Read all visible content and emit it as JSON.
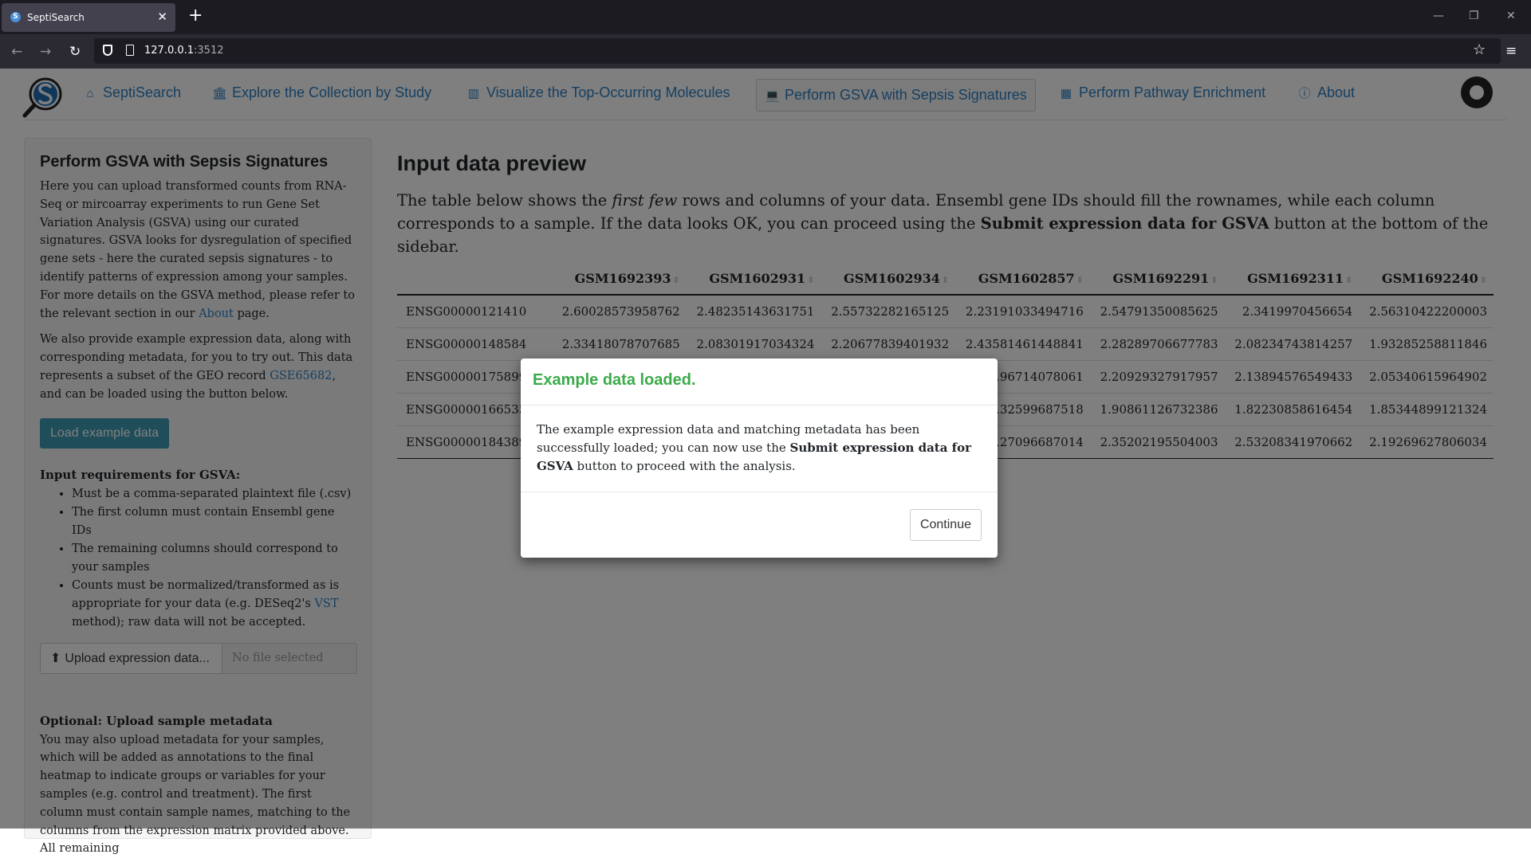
{
  "browser": {
    "tab_title": "SeptiSearch",
    "url_host": "127.0.0.1",
    "url_port": ":3512"
  },
  "nav": {
    "items": [
      {
        "label": "SeptiSearch",
        "icon": "home-icon"
      },
      {
        "label": "Explore the Collection by Study",
        "icon": "institution-icon"
      },
      {
        "label": "Visualize the Top-Occurring Molecules",
        "icon": "bar-chart-icon"
      },
      {
        "label": "Perform GSVA with Sepsis Signatures",
        "icon": "laptop-icon"
      },
      {
        "label": "Perform Pathway Enrichment",
        "icon": "calculator-icon"
      },
      {
        "label": "About",
        "icon": "info-circle-icon"
      }
    ],
    "active_index": 3
  },
  "sidebar": {
    "title": "Perform GSVA with Sepsis Signatures",
    "intro_text": "Here you can upload transformed counts from RNA-Seq or mircoarray experiments to run Gene Set Variation Analysis (GSVA) using our curated signatures. GSVA looks for dysregulation of specified gene sets - here the curated sepsis signatures - to identify patterns of expression among your samples. For more details on the GSVA method, please refer to the relevant section in our ",
    "intro_link": "About",
    "intro_end": " page.",
    "example_text": "We also provide example expression data, along with corresponding metadata, for you to try out. This data represents a subset of the GEO record ",
    "example_link": "GSE65682",
    "example_end": ", and can be loaded using the button below.",
    "load_button": "Load example data",
    "req_heading": "Input requirements for GSVA:",
    "req_items": [
      "Must be a comma-separated plaintext file (.csv)",
      "The first column must contain Ensembl gene IDs",
      "The remaining columns should correspond to your samples"
    ],
    "req_last_start": "Counts must be normalized/transformed as is appropriate for your data (e.g. DESeq2's ",
    "req_last_link": "VST",
    "req_last_end": " method); raw data will not be accepted.",
    "upload_button": "Upload expression data...",
    "upload_placeholder": "No file selected",
    "opt_heading": "Optional: Upload sample metadata",
    "opt_text": "You may also upload metadata for your samples, which will be added as annotations to the final heatmap to indicate groups or variables for your samples (e.g. control and treatment). The first column must contain sample names, matching to the columns from the expression matrix provided above. All remaining"
  },
  "main": {
    "title": "Input data preview",
    "desc_start": "The table below shows the ",
    "desc_em": "first few",
    "desc_mid": " rows and columns of your data. Ensembl gene IDs should fill the rownames, while each column corresponds to a sample. If the data looks OK, you can proceed using the ",
    "desc_strong": "Submit expression data for GSVA",
    "desc_end": " button at the bottom of the sidebar.",
    "table": {
      "columns": [
        "GSM1692393",
        "GSM1602931",
        "GSM1602934",
        "GSM1602857",
        "GSM1692291",
        "GSM1692311",
        "GSM1692240"
      ],
      "rows": [
        {
          "id": "ENSG00000121410",
          "values": [
            "2.60028573958762",
            "2.48235143631751",
            "2.55732282165125",
            "2.23191033494716",
            "2.54791350085625",
            "2.3419970456654",
            "2.56310422200003"
          ]
        },
        {
          "id": "ENSG00000148584",
          "values": [
            "2.33418078707685",
            "2.08301917034324",
            "2.20677839401932",
            "2.43581461448841",
            "2.28289706677783",
            "2.08234743814257",
            "1.93285258811846"
          ]
        },
        {
          "id": "ENSG00000175899",
          "values": [
            "",
            "",
            "",
            "...96714078061",
            "2.20929327917957",
            "2.13894576549433",
            "2.05340615964902"
          ]
        },
        {
          "id": "ENSG00000166535",
          "values": [
            "",
            "",
            "",
            "...32599687518",
            "1.90861126732386",
            "1.82230858616454",
            "1.85344899121324"
          ]
        },
        {
          "id": "ENSG00000184389",
          "values": [
            "",
            "",
            "",
            "...27096687014",
            "2.35202195504003",
            "2.53208341970662",
            "2.19269627806034"
          ]
        }
      ]
    }
  },
  "modal": {
    "title": "Example data loaded.",
    "body_start": "The example expression data and matching metadata has been successfully loaded; you can now use the ",
    "body_strong": "Submit expression data for GSVA",
    "body_end": " button to proceed with the analysis.",
    "button": "Continue",
    "title_color": "#3bab4a"
  }
}
